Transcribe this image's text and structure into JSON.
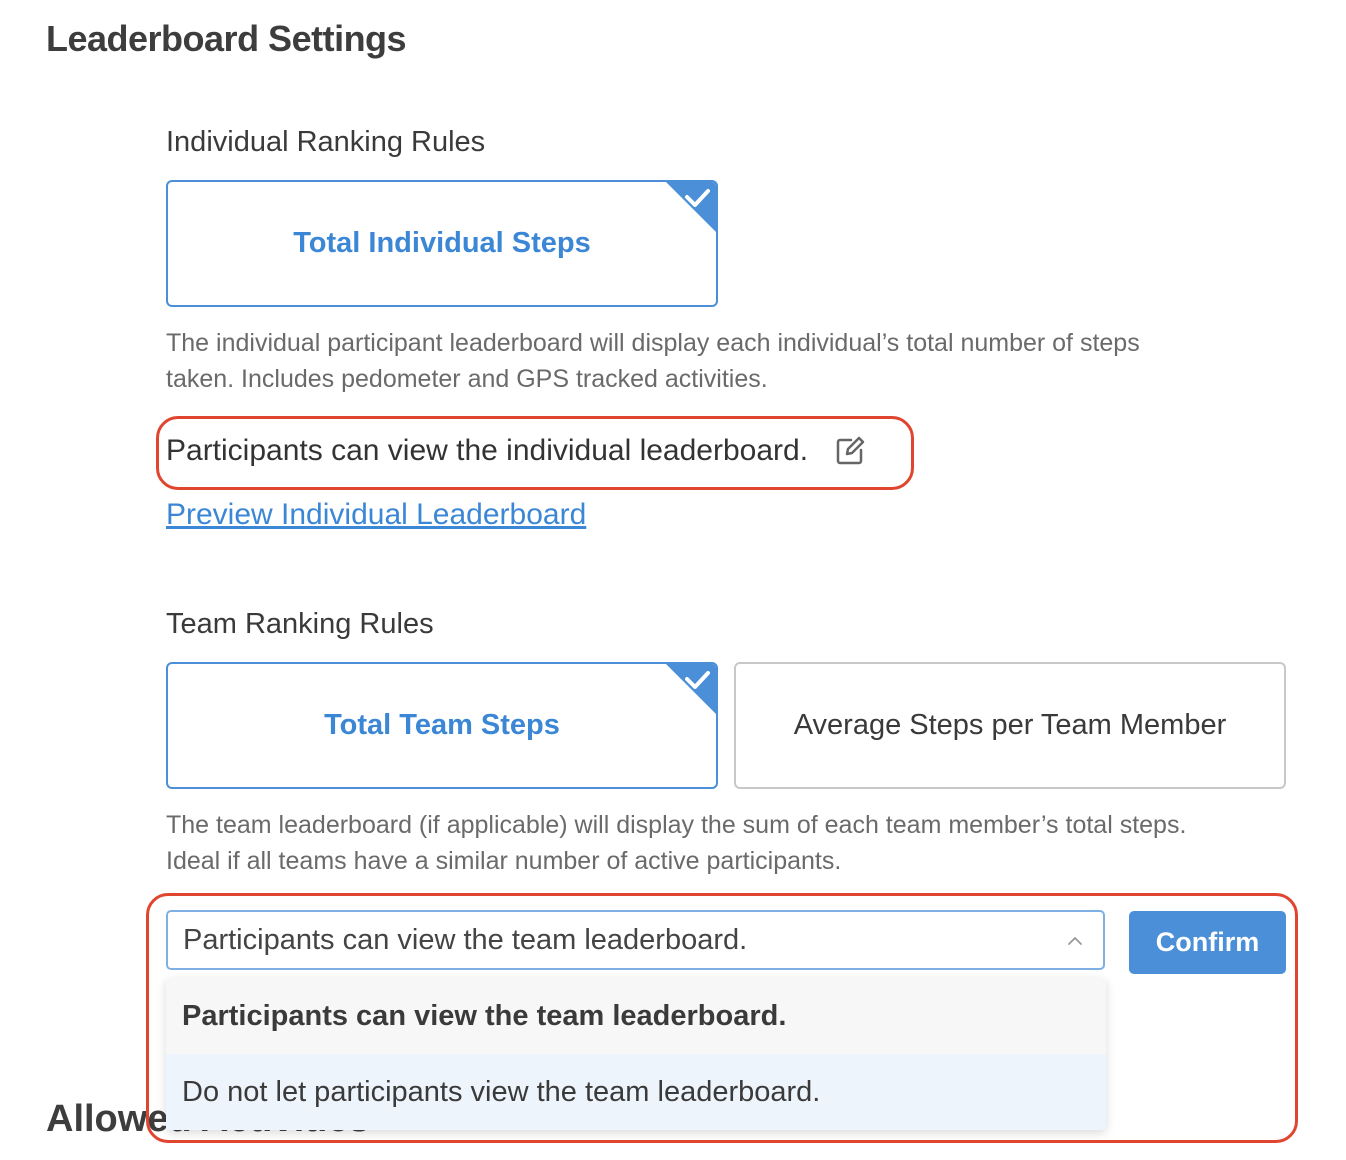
{
  "page": {
    "title": "Leaderboard Settings"
  },
  "individual": {
    "section_label": "Individual Ranking Rules",
    "options": [
      {
        "label": "Total Individual Steps",
        "selected": true
      }
    ],
    "description_line1": "The individual participant leaderboard will display each individual’s total number of steps",
    "description_line2": "taken. Includes pedometer and GPS tracked activities.",
    "visibility_text": "Participants can view the individual leaderboard.",
    "preview_link": "Preview Individual Leaderboard"
  },
  "team": {
    "section_label": "Team Ranking Rules",
    "options": [
      {
        "label": "Total Team Steps",
        "selected": true
      },
      {
        "label": "Average Steps per Team Member",
        "selected": false
      }
    ],
    "description_line1": "The team leaderboard (if applicable) will display the sum of each team member’s total steps.",
    "description_line2": "Ideal if all teams have a similar number of active participants.",
    "visibility_select": {
      "value": "Participants can view the team leaderboard.",
      "options": [
        "Participants can view the team leaderboard.",
        "Do not let participants view the team leaderboard."
      ]
    },
    "confirm_label": "Confirm"
  },
  "next_section": {
    "title": "Allowed Activities"
  },
  "colors": {
    "accent": "#4a8fd8",
    "highlight": "#e0452f"
  }
}
